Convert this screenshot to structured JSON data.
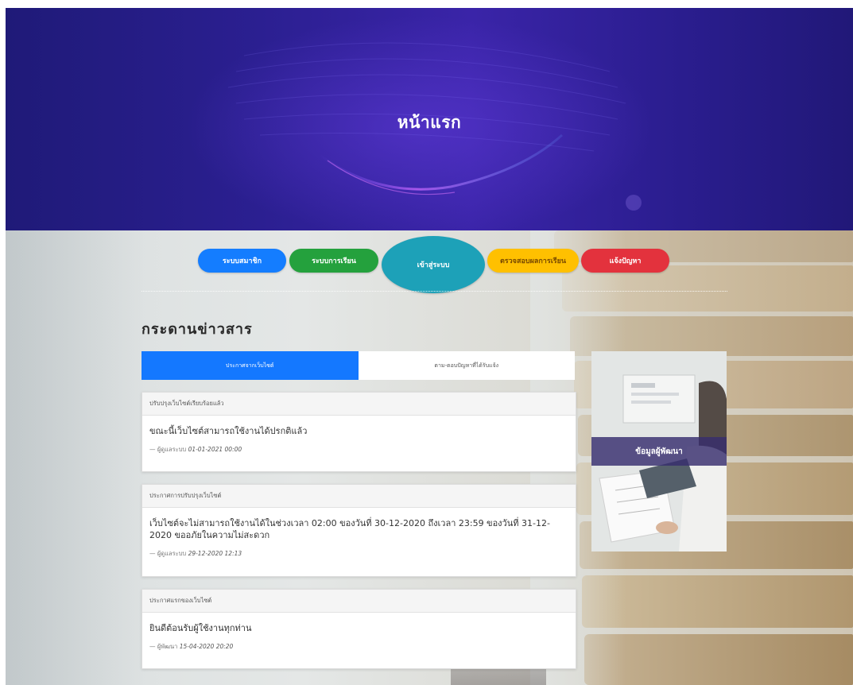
{
  "hero": {
    "title": "หน้าแรก"
  },
  "nav": {
    "members": "ระบบสมาชิก",
    "study": "ระบบการเรียน",
    "login": "เข้าสู่ระบบ",
    "results": "ตรวจสอบผลการเรียน",
    "report": "แจ้งปัญหา"
  },
  "board": {
    "title": "กระดานข่าวสาร",
    "tabs": [
      "ประกาศจากเว็บไซต์",
      "ตาม-ตอบปัญหาที่ได้รับแจ้ง"
    ]
  },
  "news": [
    {
      "heading": "ปรับปรุงเว็บไซต์เรียบร้อยแล้ว",
      "text": "ขณะนี้เว็บไซต์สามารถใช้งานได้ปรกติแล้ว",
      "author": "— ผู้ดูแลระบบ",
      "date": "01-01-2021 00:00"
    },
    {
      "heading": "ประกาศการปรับปรุงเว็บไซต์",
      "text": "เว็บไซต์จะไม่สามารถใช้งานได้ในช่วงเวลา 02:00 ของวันที่ 30-12-2020 ถึงเวลา 23:59 ของวันที่ 31-12-2020 ขออภัยในความไม่สะดวก",
      "author": "— ผู้ดูแลระบบ",
      "date": "29-12-2020 12:13"
    },
    {
      "heading": "ประกาศแรกของเว็บไซต์",
      "text": "ยินดีต้อนรับผู้ใช้งานทุกท่าน",
      "author": "— ผู้พัฒนา",
      "date": "15-04-2020 20:20"
    }
  ],
  "developer": {
    "label": "ข้อมูลผู้พัฒนา"
  },
  "colors": {
    "hero": "#2b1f91",
    "blue": "#147dff",
    "green": "#24a13d",
    "teal": "#1da1b8",
    "yellow": "#ffc000",
    "red": "#e3323d"
  }
}
